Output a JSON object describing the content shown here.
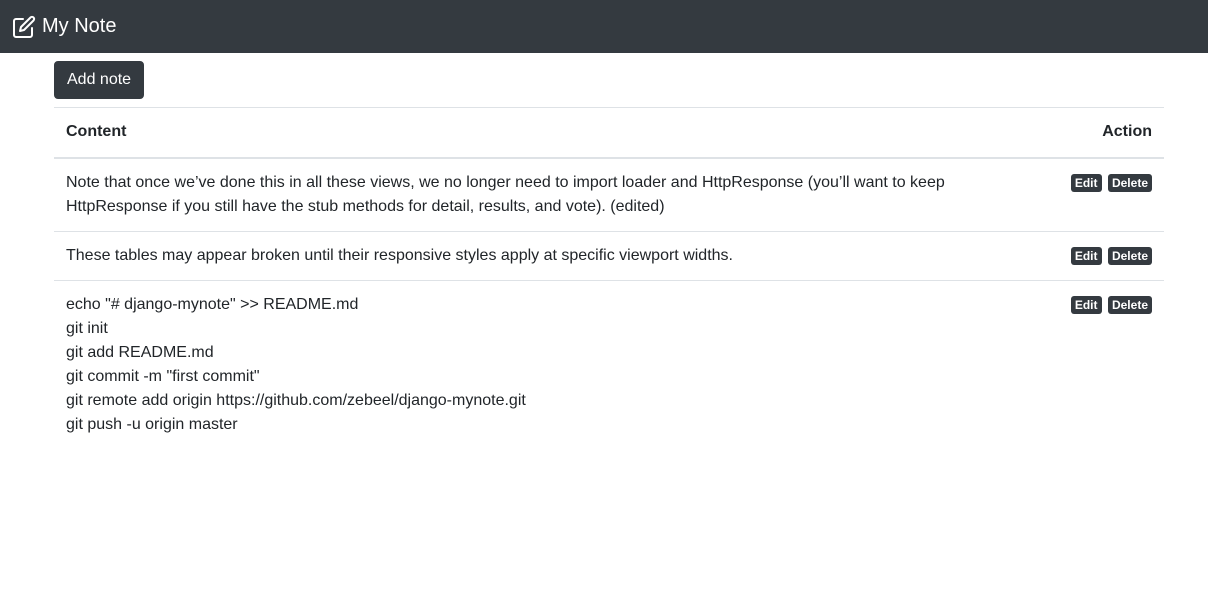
{
  "navbar": {
    "brand": "My Note",
    "brand_icon": "edit-icon"
  },
  "toolbar": {
    "add_label": "Add note"
  },
  "table": {
    "headers": {
      "content": "Content",
      "action": "Action"
    },
    "rows": [
      {
        "lines": [
          "Note that once we’ve done this in all these views, we no longer need to import loader and HttpResponse (you’ll want to keep",
          "HttpResponse if you still have the stub methods for detail, results, and vote). (edited)"
        ],
        "edit": "Edit",
        "delete": "Delete"
      },
      {
        "lines": [
          "These tables may appear broken until their responsive styles apply at specific viewport widths."
        ],
        "edit": "Edit",
        "delete": "Delete"
      },
      {
        "lines": [
          "echo \"# django-mynote\" >> README.md",
          "git init",
          "git add README.md",
          "git commit -m \"first commit\"",
          "git remote add origin https://github.com/zebeel/django-mynote.git",
          "git push -u origin master"
        ],
        "edit": "Edit",
        "delete": "Delete"
      }
    ]
  },
  "colors": {
    "navbar_bg": "#343a40",
    "button_bg": "#343a40",
    "border": "#dee2e6",
    "text": "#212529"
  }
}
